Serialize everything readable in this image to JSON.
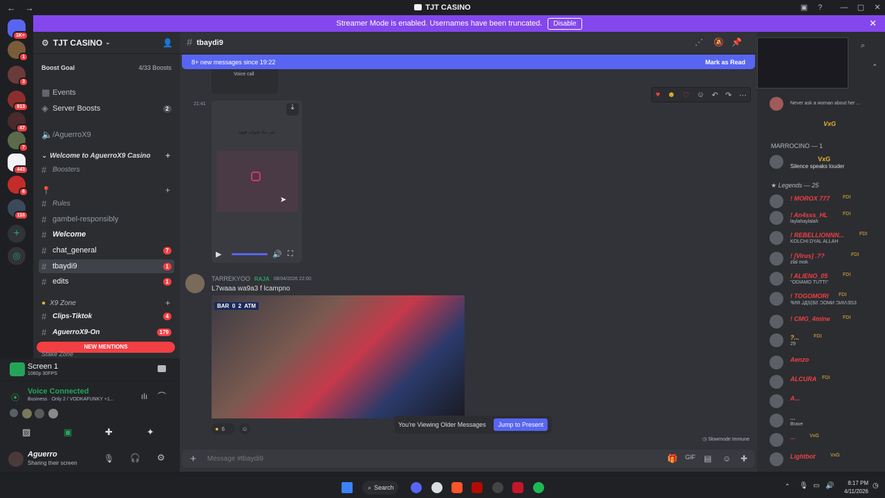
{
  "window": {
    "title": "TJT CASINO"
  },
  "banner": {
    "text": "Streamer Mode is enabled. Usernames have been truncated.",
    "button": "Disable"
  },
  "rail": {
    "badges": [
      "1K+",
      "1",
      "3",
      "913",
      "47",
      "7",
      "443",
      "6",
      "116"
    ]
  },
  "server": {
    "name": "TJT CASINO"
  },
  "boost": {
    "label": "Boost Goal",
    "progress": "4/33 Boosts"
  },
  "sidebar": {
    "events": "Events",
    "server_boosts": "Server Boosts",
    "server_boosts_count": "2",
    "voice_channel": "/AguerroX9",
    "category_welcome": "Welcome to AguerroX9 Casino",
    "boosters": "Boosters",
    "rules": "Rules",
    "gambel": "gambel-responsibly",
    "welcome": "Welcome",
    "chat_general": "chat_general",
    "chat_general_count": "7",
    "tbaydi9": "tbaydi9",
    "tbaydi9_count": "1",
    "edits": "edits",
    "edits_count": "1",
    "category_x9": "X9 Zone",
    "clips": "Clips-Tiktok",
    "clips_count": "4",
    "aguerro_on": "AguerroX9-On",
    "aguerro_on_count": "179",
    "new_mentions": "NEW MENTIONS",
    "stake_zone": "Stake Zone"
  },
  "panel": {
    "screen": "Screen 1",
    "screen_quality": "1080p 30FPS",
    "voice_connected": "Voice Connected",
    "voice_detail": "Business · Only 2 / VODKAFUNKY +1...",
    "username": "Aguerro",
    "user_status": "Sharing their screen"
  },
  "channel": {
    "name": "tbaydi9"
  },
  "newbar": {
    "text": "8+ new messages since 19:22",
    "action": "Mark as Read"
  },
  "messages": {
    "voice_call": "Voice call",
    "time1": "21:41",
    "video_caption": "غير تبتا شوف هيهه",
    "author": "TARREKYOO",
    "role": "RAJA",
    "timestamp": "08/04/2026 22:00",
    "text": "L7waaa wa9a3 f lcampno",
    "scoreboard": "BAR  0  2  ATM",
    "reaction_count": "6"
  },
  "older": {
    "text": "You're Viewing Older Messages",
    "button": "Jump to Present"
  },
  "slowmode": "Slowmode Immune",
  "composer": {
    "placeholder": "Message #tbaydi9"
  },
  "members": {
    "first_status": "Never ask a woman about her ...",
    "vxg1": "VxG",
    "marrocino": "MARROCINO — 1",
    "vxg2": "VxG",
    "silence": "Silence speaks louder",
    "legends": "Legends — 25",
    "list": [
      {
        "name": "! MOROX 777",
        "tag": "FDI",
        "status": ""
      },
      {
        "name": "! An4sss_HL",
        "tag": "FDI",
        "status": "laylahaylalah"
      },
      {
        "name": "! REBELLIONNN...",
        "tag": "FDI",
        "status": "KOLCHI DYAL ALLAH"
      },
      {
        "name": "! [Virus] .??",
        "tag": "FDI",
        "status": "zlal mok"
      },
      {
        "name": "! ALIENO_05",
        "tag": "FDI",
        "status": "\"ODIAMO TUTTI\""
      },
      {
        "name": "! TOGOMORI",
        "tag": "FDI",
        "status": "ꟻИЯ ⅃ДS|ƎƧ ƆOMИ ƆИIɅƎS3"
      },
      {
        "name": "! CMG_4mine",
        "tag": "FDI",
        "status": ""
      },
      {
        "name": "?...",
        "tag": "FDI",
        "status": "29"
      },
      {
        "name": "Aenzo",
        "tag": "",
        "status": ""
      },
      {
        "name": "ALCURA",
        "tag": "FDI",
        "status": ""
      },
      {
        "name": "A...",
        "tag": "",
        "status": ""
      },
      {
        "name": "...",
        "tag": "",
        "status": "Brave"
      },
      {
        "name": "...",
        "tag": "VxG",
        "status": ""
      },
      {
        "name": "Lightbot",
        "tag": "VxG",
        "status": ""
      }
    ]
  },
  "taskbar": {
    "search": "Search",
    "time": "8:17 PM",
    "date": "4/11/2026"
  }
}
